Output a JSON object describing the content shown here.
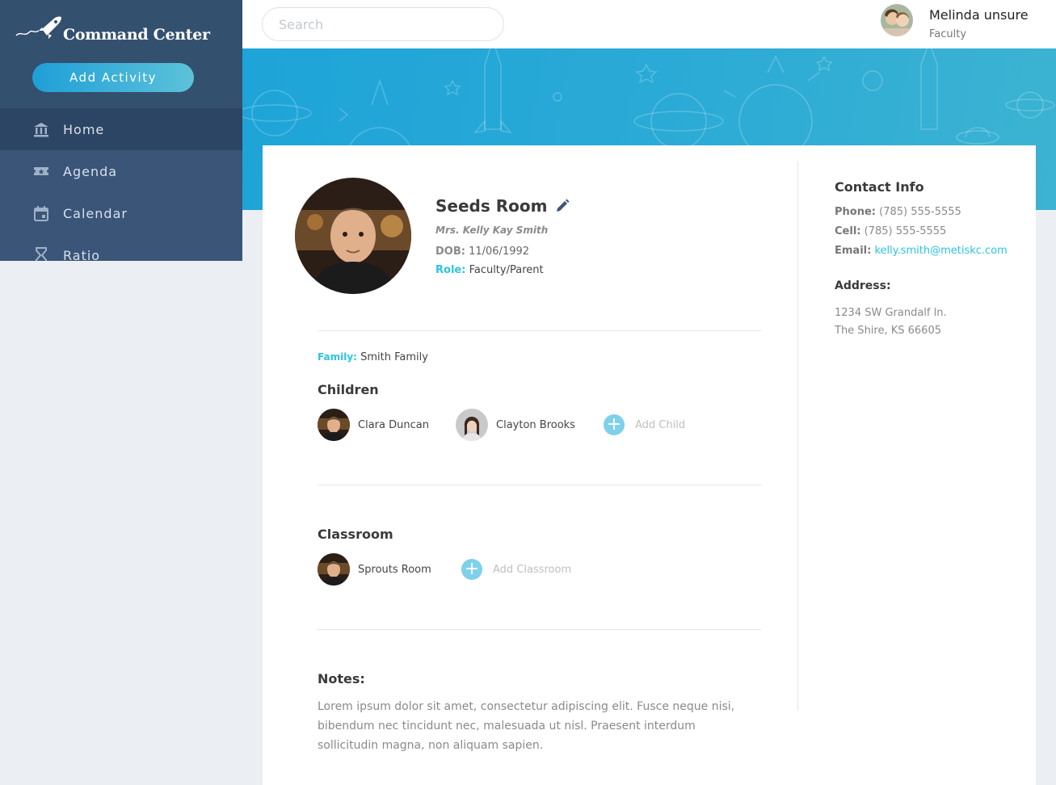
{
  "app": {
    "title": "Command Center"
  },
  "sidebar": {
    "add_button": "Add Activity",
    "items": [
      {
        "label": "Home",
        "icon": "bank-icon",
        "active": true
      },
      {
        "label": "Agenda",
        "icon": "ticket-icon",
        "active": false
      },
      {
        "label": "Calendar",
        "icon": "calendar-icon",
        "active": false
      },
      {
        "label": "Ratio",
        "icon": "hourglass-icon",
        "active": false
      }
    ]
  },
  "header": {
    "search_placeholder": "Search",
    "user": {
      "name": "Melinda unsure",
      "role": "Faculty"
    }
  },
  "profile": {
    "room": "Seeds Room",
    "name": "Mrs. Kelly Kay Smith",
    "dob_label": "DOB:",
    "dob": "11/06/1992",
    "role_label": "Role:",
    "role": "Faculty/Parent",
    "family_label": "Family:",
    "family": "Smith Family"
  },
  "children": {
    "title": "Children",
    "items": [
      {
        "name": "Clara Duncan"
      },
      {
        "name": "Clayton Brooks"
      }
    ],
    "add_label": "Add Child"
  },
  "classroom": {
    "title": "Classroom",
    "items": [
      {
        "name": "Sprouts Room"
      }
    ],
    "add_label": "Add Classroom"
  },
  "notes": {
    "title": "Notes:",
    "text": "Lorem ipsum dolor sit amet, consectetur adipiscing elit. Fusce neque nisi, bibendum nec tincidunt nec, malesuada ut nisl. Praesent interdum sollicitudin magna, non aliquam sapien."
  },
  "contact": {
    "title": "Contact Info",
    "phone_label": "Phone:",
    "phone": "(785) 555-5555",
    "cell_label": "Cell:",
    "cell": "(785) 555-5555",
    "email_label": "Email:",
    "email": "kelly.smith@metiskc.com",
    "address_title": "Address:",
    "address_line1": "1234 SW Grandalf ln.",
    "address_line2": "The Shire, KS 66605"
  },
  "colors": {
    "accent": "#2cc4e0",
    "sidebar": "#3a5578",
    "banner": "#1ea4d8"
  }
}
